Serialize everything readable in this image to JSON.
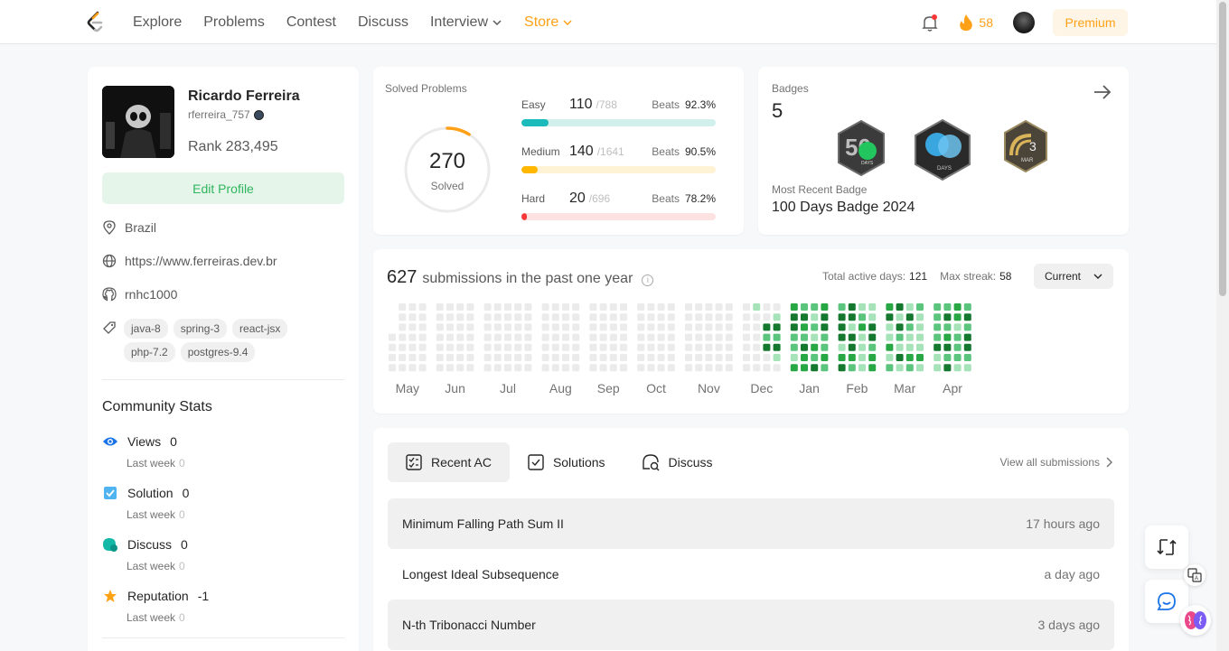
{
  "nav": {
    "links": [
      "Explore",
      "Problems",
      "Contest",
      "Discuss",
      "Interview",
      "Store"
    ],
    "streak": "58",
    "premium": "Premium"
  },
  "profile": {
    "name": "Ricardo Ferreira",
    "handle": "rferreira_757",
    "rank": "Rank 283,495",
    "edit": "Edit Profile",
    "location": "Brazil",
    "website": "https://www.ferreiras.dev.br",
    "github": "rnhc1000",
    "skills": [
      "java-8",
      "spring-3",
      "react-jsx",
      "php-7.2",
      "postgres-9.4"
    ]
  },
  "community": {
    "title": "Community Stats",
    "last_week_label": "Last week",
    "stats": [
      {
        "label": "Views",
        "value": "0",
        "last_week": "0"
      },
      {
        "label": "Solution",
        "value": "0",
        "last_week": "0"
      },
      {
        "label": "Discuss",
        "value": "0",
        "last_week": "0"
      },
      {
        "label": "Reputation",
        "value": "-1",
        "last_week": "0"
      }
    ]
  },
  "solved": {
    "title": "Solved Problems",
    "total": "270",
    "total_label": "Solved",
    "fraction": 0.0877,
    "beats_label": "Beats",
    "levels": [
      {
        "name": "Easy",
        "count": "110",
        "total": "/788",
        "beats": "92.3%",
        "fraction": 0.1396,
        "color": "#1cbaba",
        "track": "#d1f0ec"
      },
      {
        "name": "Medium",
        "count": "140",
        "total": "/1641",
        "beats": "90.5%",
        "fraction": 0.0853,
        "color": "#ffb700",
        "track": "#fff3d6"
      },
      {
        "name": "Hard",
        "count": "20",
        "total": "/696",
        "beats": "78.2%",
        "fraction": 0.0287,
        "color": "#f63737",
        "track": "#fde2e2"
      }
    ]
  },
  "badges": {
    "title": "Badges",
    "count": "5",
    "recent_label": "Most Recent Badge",
    "recent_value": "100 Days Badge 2024",
    "items": [
      {
        "icon": "fifty-days-badge-icon",
        "text": "DAYS",
        "number": "50"
      },
      {
        "icon": "hundred-days-badge-icon",
        "text": "DAYS"
      },
      {
        "icon": "march-badge-icon",
        "text": "MAR",
        "number": "3"
      }
    ]
  },
  "submissions": {
    "count": "627",
    "text": "submissions in the past one year",
    "active_label": "Total active days:",
    "active_value": "121",
    "streak_label": "Max streak:",
    "streak_value": "58",
    "selector": "Current",
    "months": [
      "May",
      "Jun",
      "Jul",
      "Aug",
      "Sep",
      "Oct",
      "Nov",
      "Dec",
      "Jan",
      "Feb",
      "Mar",
      "Apr"
    ],
    "colors": {
      "empty": "#ebebeb",
      "l1": "#a6e3b8",
      "l2": "#5bc47d",
      "l3": "#28a745",
      "l4": "#14782f"
    }
  },
  "recent": {
    "tabs": [
      "Recent AC",
      "Solutions",
      "Discuss"
    ],
    "view_all": "View all submissions",
    "items": [
      {
        "title": "Minimum Falling Path Sum II",
        "time": "17 hours ago"
      },
      {
        "title": "Longest Ideal Subsequence",
        "time": "a day ago"
      },
      {
        "title": "N-th Tribonacci Number",
        "time": "3 days ago"
      }
    ]
  }
}
